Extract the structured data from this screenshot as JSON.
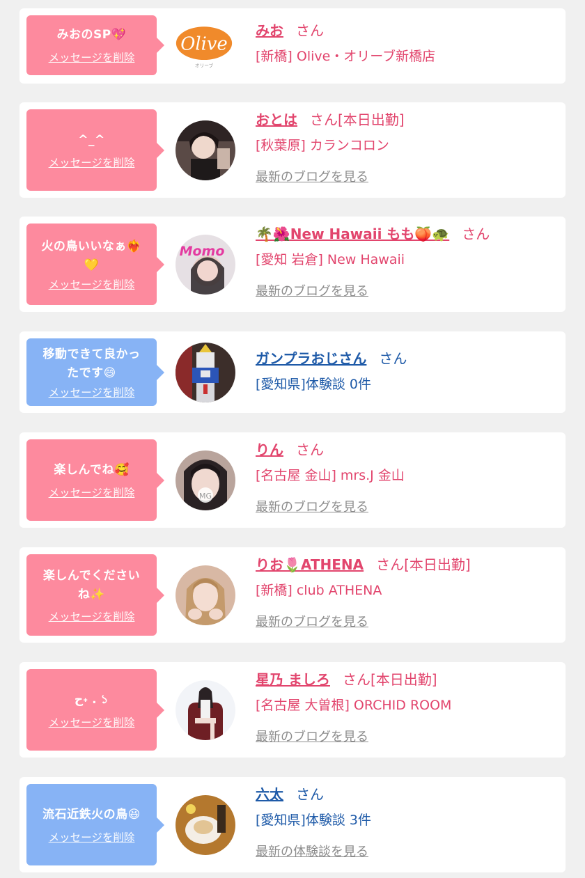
{
  "colors": {
    "pink_bubble": "#fd8a9e",
    "blue_bubble": "#87b3f5",
    "pink_text": "#e2456d",
    "blue_text": "#1e5aa8",
    "link_gray": "#8c8c8c"
  },
  "delete_label": "メッセージを削除",
  "items": [
    {
      "message": "みおのSP💖",
      "name": "みお",
      "suffix": "さん",
      "shop": "[新橋] Olive・オリーブ新橋店",
      "avatar": "olive-logo"
    },
    {
      "message": "^_^",
      "name": "おとは",
      "suffix": "さん[本日出勤]",
      "shop": "[秋葉原] カランコロン",
      "link": "最新のブログを見る",
      "avatar": "girl-photo"
    },
    {
      "message_line1": "火の鳥いいなぁ❤️‍🔥",
      "message_line2": "💛",
      "name": "🌴🌺New Hawaii もも🍑🐢",
      "suffix": "さん",
      "shop": "[愛知 岩倉] New Hawaii",
      "link": "最新のブログを見る",
      "avatar": "girl-photo"
    },
    {
      "message_line1": "移動できて良かっ",
      "message_line2": "たです😄",
      "name": "ガンプラおじさん",
      "suffix": "さん",
      "shop": "[愛知県]体験談 0件",
      "avatar": "gundam-photo"
    },
    {
      "message": "楽しんでね🥰",
      "name": "りん",
      "suffix": "さん",
      "shop": "[名古屋 金山] mrs.J 金山",
      "link": "最新のブログを見る",
      "avatar": "girl-photo"
    },
    {
      "message_line1": "楽しんでください",
      "message_line2": "ね✨",
      "name": "りお🌷ATHENA",
      "suffix": "さん[本日出勤]",
      "shop": "[新橋] club ATHENA",
      "link": "最新のブログを見る",
      "avatar": "girl-photo"
    },
    {
      "message": "ح˖ . ১",
      "name": "星乃 ましろ",
      "suffix": "さん[本日出勤]",
      "shop": "[名古屋 大曽根] ORCHID ROOM",
      "link": "最新のブログを見る",
      "avatar": "girl-photo"
    },
    {
      "message": "流石近鉄火の鳥😆",
      "name": "六太",
      "suffix": "さん",
      "shop": "[愛知県]体験談 3件",
      "link": "最新の体験談を見る",
      "avatar": "food-photo"
    }
  ]
}
